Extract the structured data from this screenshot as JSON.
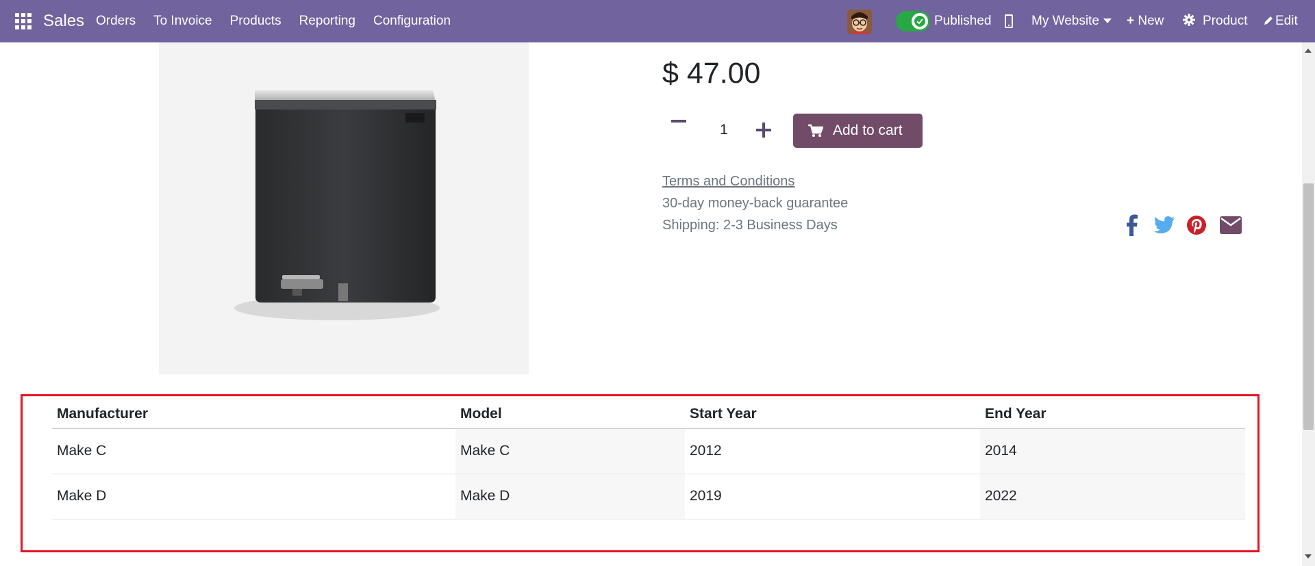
{
  "navbar": {
    "brand": "Sales",
    "menu": [
      "Orders",
      "To Invoice",
      "Products",
      "Reporting",
      "Configuration"
    ],
    "published_label": "Published",
    "website_label": "My Website",
    "new_label": "New",
    "product_label": "Product",
    "edit_label": "Edit",
    "bg_color": "#71639e"
  },
  "product": {
    "price": "$ 47.00",
    "quantity": "1",
    "add_to_cart_label": "Add to cart",
    "terms_label": "Terms and Conditions",
    "guarantee": "30-day money-back guarantee",
    "shipping": "Shipping: 2-3 Business Days",
    "cart_color": "#714b67"
  },
  "share_icons": [
    "facebook-icon",
    "twitter-icon",
    "pinterest-icon",
    "email-icon"
  ],
  "vehicle_table": {
    "headers": [
      "Manufacturer",
      "Model",
      "Start Year",
      "End Year"
    ],
    "rows": [
      [
        "Make C",
        "Make C",
        "2012",
        "2014"
      ],
      [
        "Make D",
        "Make D",
        "2019",
        "2022"
      ]
    ],
    "highlight_color": "#e81123"
  }
}
